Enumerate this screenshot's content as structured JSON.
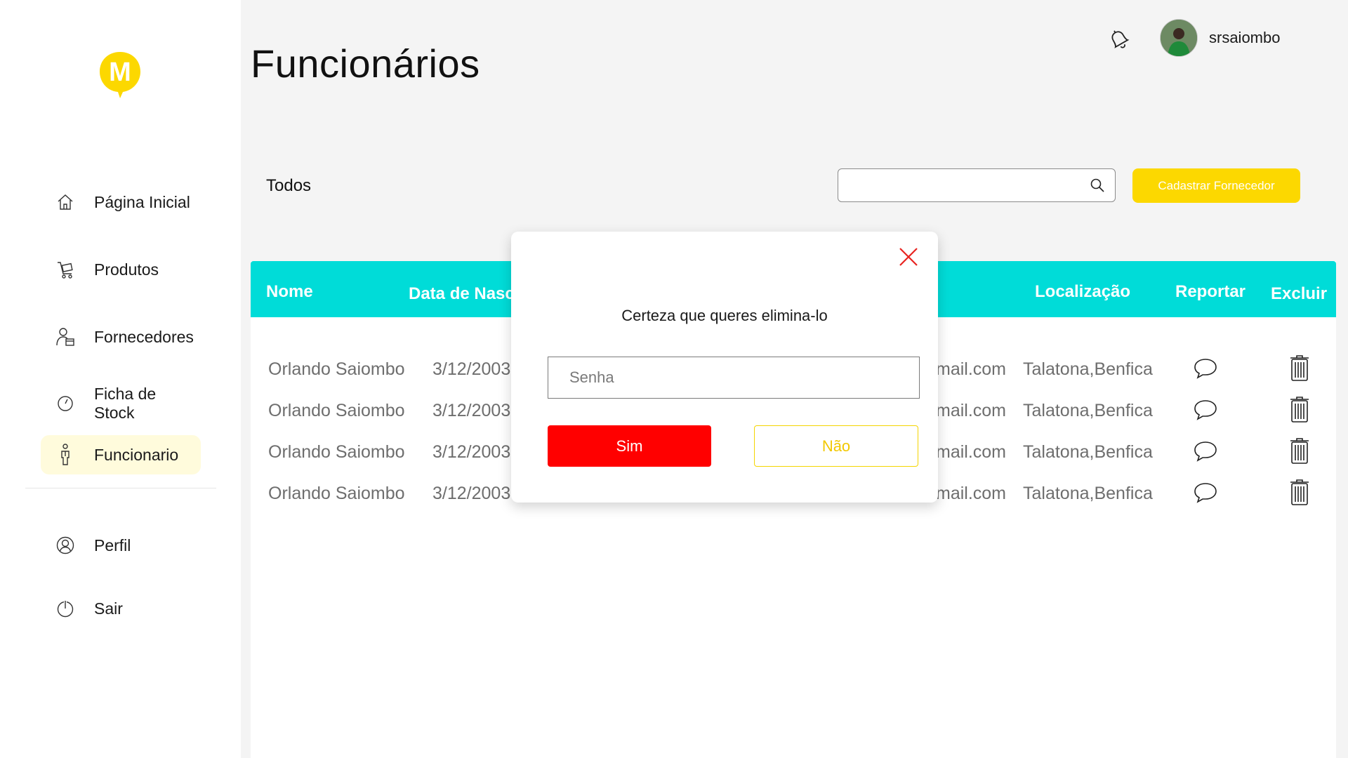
{
  "app": {
    "title": "Funcionários"
  },
  "brand": {
    "logo_letter": "M",
    "color": "#FCD800"
  },
  "sidebar": {
    "items": [
      {
        "label": "Página Inicial",
        "icon": "home-icon"
      },
      {
        "label": "Produtos",
        "icon": "cart-icon"
      },
      {
        "label": "Fornecedores",
        "icon": "supplier-icon"
      },
      {
        "label": "Ficha de Stock",
        "icon": "clock-icon"
      },
      {
        "label": "Funcionario",
        "icon": "person-icon",
        "active": true
      },
      {
        "label": "Perfil",
        "icon": "profile-icon"
      },
      {
        "label": "Sair",
        "icon": "power-icon"
      }
    ]
  },
  "header": {
    "username": "srsaiombo"
  },
  "toolbar": {
    "filter_label": "Todos",
    "search_placeholder": "",
    "add_button_label": "Cadastrar  Fornecedor"
  },
  "table": {
    "columns": [
      "Nome",
      "Data de Nasc",
      "Localização",
      "Reportar",
      "Excluir"
    ],
    "rows": [
      {
        "name": "Orlando Saiombo",
        "birth": "3/12/2003",
        "email": "mail.com",
        "location": "Talatona,Benfica"
      },
      {
        "name": "Orlando Saiombo",
        "birth": "3/12/2003",
        "email": "mail.com",
        "location": "Talatona,Benfica"
      },
      {
        "name": "Orlando Saiombo",
        "birth": "3/12/2003",
        "email": "mail.com",
        "location": "Talatona,Benfica"
      },
      {
        "name": "Orlando Saiombo",
        "birth": "3/12/2003",
        "email": "mail.com",
        "location": "Talatona,Benfica"
      }
    ]
  },
  "modal": {
    "message": "Certeza que queres elimina-lo",
    "password_placeholder": "Senha",
    "yes_label": "Sim",
    "no_label": "Não"
  },
  "colors": {
    "accent_yellow": "#FCD800",
    "table_header": "#00DCD8",
    "danger": "#FF0000",
    "active_nav_bg": "#FFFBDC"
  }
}
